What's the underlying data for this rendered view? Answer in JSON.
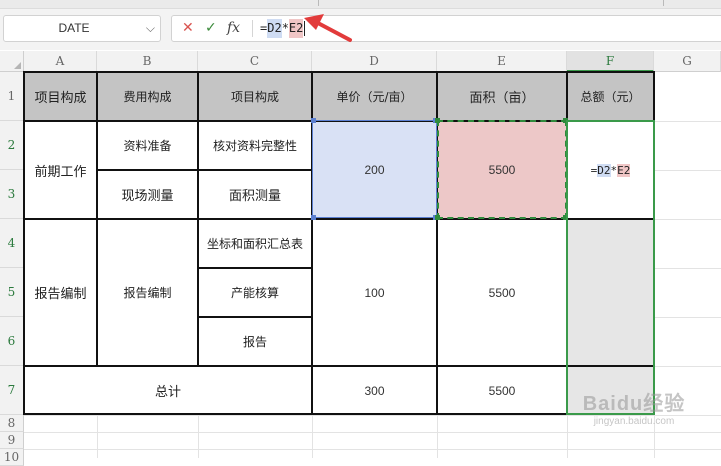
{
  "name_box": {
    "value": "DATE"
  },
  "formula_bar": {
    "prefix": "=",
    "ref1": "D2",
    "op": "*",
    "ref2": "E2"
  },
  "columns": [
    "A",
    "B",
    "C",
    "D",
    "E",
    "F",
    "G"
  ],
  "rows": [
    "1",
    "2",
    "3",
    "4",
    "5",
    "6",
    "7",
    "8",
    "9",
    "10"
  ],
  "table": {
    "headers": {
      "a": "项目构成",
      "b": "费用构成",
      "c": "项目构成",
      "d": "单价（元/亩）",
      "e": "面积（亩）",
      "f": "总额（元）"
    },
    "group1": {
      "a": "前期工作",
      "b2": "资料准备",
      "c2": "核对资料完整性",
      "b3": "现场测量",
      "c3": "面积测量",
      "d": "200",
      "e": "5500",
      "f_prefix": "=",
      "f_ref1": "D2",
      "f_op": "*",
      "f_ref2": "E2"
    },
    "group2": {
      "a": "报告编制",
      "b": "报告编制",
      "c4": "坐标和面积汇总表",
      "c5": "产能核算",
      "c6": "报告",
      "d": "100",
      "e": "5500"
    },
    "total": {
      "label": "总计",
      "d": "300",
      "e": "5500"
    }
  },
  "watermark": {
    "logo": "Baidu经验",
    "url": "jingyan.baidu.com"
  },
  "colors": {
    "selection_green": "#3a9a4a",
    "ref_blue": "#d9e1f5",
    "ref_red": "#edc8c8",
    "arrow_red": "#e23b3b",
    "header_gray": "#c4c4c4"
  }
}
